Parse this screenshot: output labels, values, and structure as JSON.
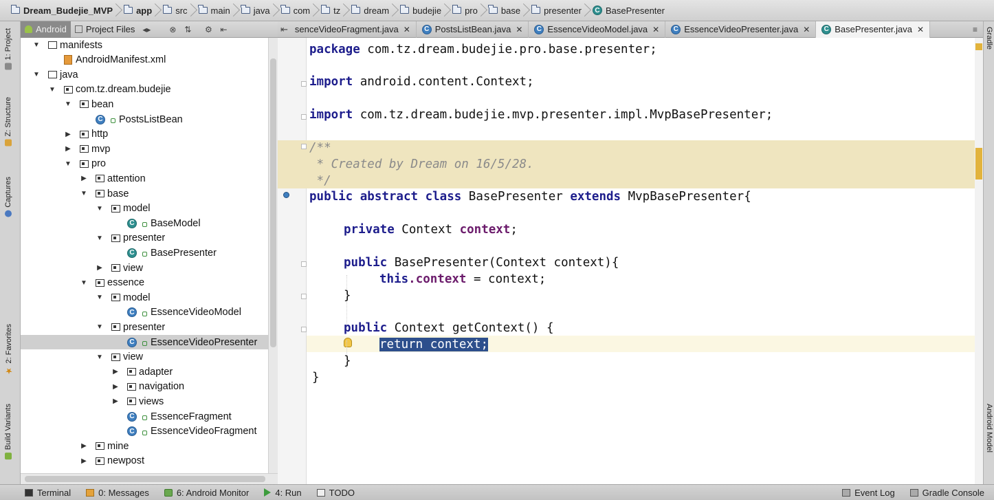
{
  "breadcrumbs": [
    {
      "label": "Dream_Budejie_MVP",
      "icon": "module-icon",
      "bold": true
    },
    {
      "label": "app",
      "icon": "folder-icon",
      "bold": true
    },
    {
      "label": "src",
      "icon": "folder-icon"
    },
    {
      "label": "main",
      "icon": "folder-icon"
    },
    {
      "label": "java",
      "icon": "folder-icon"
    },
    {
      "label": "com",
      "icon": "folder-icon"
    },
    {
      "label": "tz",
      "icon": "folder-icon"
    },
    {
      "label": "dream",
      "icon": "folder-icon"
    },
    {
      "label": "budejie",
      "icon": "folder-icon"
    },
    {
      "label": "pro",
      "icon": "folder-icon"
    },
    {
      "label": "base",
      "icon": "folder-icon"
    },
    {
      "label": "presenter",
      "icon": "folder-icon"
    },
    {
      "label": "BasePresenter",
      "icon": "class-icon"
    }
  ],
  "left_strip": {
    "project": "1: Project",
    "structure": "Z: Structure",
    "captures": "Captures",
    "favorites": "2: Favorites",
    "build_variants": "Build Variants"
  },
  "right_strip": {
    "gradle": "Gradle",
    "android_model": "Android Model"
  },
  "project_toolbar": {
    "android_tab": "Android",
    "project_files_tab": "Project Files"
  },
  "tree": [
    {
      "label": "manifests",
      "depth": 0,
      "arrow": "open",
      "icon": "dir"
    },
    {
      "label": "AndroidManifest.xml",
      "depth": 1,
      "arrow": "",
      "icon": "xml"
    },
    {
      "label": "java",
      "depth": 0,
      "arrow": "open",
      "icon": "dir"
    },
    {
      "label": "com.tz.dream.budejie",
      "depth": 1,
      "arrow": "open",
      "icon": "pkg"
    },
    {
      "label": "bean",
      "depth": 2,
      "arrow": "open",
      "icon": "pkg"
    },
    {
      "label": "PostsListBean",
      "depth": 3,
      "arrow": "",
      "icon": "class"
    },
    {
      "label": "http",
      "depth": 2,
      "arrow": "closed",
      "icon": "pkg"
    },
    {
      "label": "mvp",
      "depth": 2,
      "arrow": "closed",
      "icon": "pkg"
    },
    {
      "label": "pro",
      "depth": 2,
      "arrow": "open",
      "icon": "pkg"
    },
    {
      "label": "attention",
      "depth": 3,
      "arrow": "closed",
      "icon": "pkg"
    },
    {
      "label": "base",
      "depth": 3,
      "arrow": "open",
      "icon": "pkg"
    },
    {
      "label": "model",
      "depth": 4,
      "arrow": "open",
      "icon": "pkg"
    },
    {
      "label": "BaseModel",
      "depth": 5,
      "arrow": "",
      "icon": "class-teal"
    },
    {
      "label": "presenter",
      "depth": 4,
      "arrow": "open",
      "icon": "pkg"
    },
    {
      "label": "BasePresenter",
      "depth": 5,
      "arrow": "",
      "icon": "class-teal"
    },
    {
      "label": "view",
      "depth": 4,
      "arrow": "closed",
      "icon": "pkg"
    },
    {
      "label": "essence",
      "depth": 3,
      "arrow": "open",
      "icon": "pkg"
    },
    {
      "label": "model",
      "depth": 4,
      "arrow": "open",
      "icon": "pkg"
    },
    {
      "label": "EssenceVideoModel",
      "depth": 5,
      "arrow": "",
      "icon": "class"
    },
    {
      "label": "presenter",
      "depth": 4,
      "arrow": "open",
      "icon": "pkg"
    },
    {
      "label": "EssenceVideoPresenter",
      "depth": 5,
      "arrow": "",
      "icon": "class",
      "selected": true
    },
    {
      "label": "view",
      "depth": 4,
      "arrow": "open",
      "icon": "pkg"
    },
    {
      "label": "adapter",
      "depth": 5,
      "arrow": "closed",
      "icon": "pkg"
    },
    {
      "label": "navigation",
      "depth": 5,
      "arrow": "closed",
      "icon": "pkg"
    },
    {
      "label": "views",
      "depth": 5,
      "arrow": "closed",
      "icon": "pkg"
    },
    {
      "label": "EssenceFragment",
      "depth": 5,
      "arrow": "",
      "icon": "class"
    },
    {
      "label": "EssenceVideoFragment",
      "depth": 5,
      "arrow": "",
      "icon": "class"
    },
    {
      "label": "mine",
      "depth": 3,
      "arrow": "closed",
      "icon": "pkg"
    },
    {
      "label": "newpost",
      "depth": 3,
      "arrow": "closed",
      "icon": "pkg"
    }
  ],
  "editor_tabs": [
    {
      "label": "senceVideoFragment.java",
      "active": false
    },
    {
      "label": "PostsListBean.java",
      "active": false
    },
    {
      "label": "EssenceVideoModel.java",
      "active": false
    },
    {
      "label": "EssenceVideoPresenter.java",
      "active": false
    },
    {
      "label": "BasePresenter.java",
      "active": true
    }
  ],
  "code": {
    "package_kw": "package",
    "package_name": " com.tz.dream.budejie.pro.base.presenter;",
    "import_kw": "import",
    "import1": " android.content.Context;",
    "import2": " com.tz.dream.budejie.mvp.presenter.impl.MvpBasePresenter;",
    "doc1": "/**",
    "doc2": " * Created by Dream on 16/5/28.",
    "doc3": " */",
    "public_kw": "public",
    "abstract_kw": " abstract",
    "class_kw": " class",
    "class_name": " BasePresenter ",
    "extends_kw": "extends",
    "super_name": " MvpBasePresenter{",
    "private_kw": "private",
    "ctx_type": " Context ",
    "ctx_field": "context",
    "semicolon": ";",
    "ctor_sig": " BasePresenter(Context context){",
    "this_kw": "this",
    "this_field": ".context",
    "assign": " = context;",
    "close_brace": "}",
    "getter_sig": " Context getContext() {",
    "return_stmt": "return context;"
  },
  "bottom_bar": {
    "terminal": "Terminal",
    "messages": "0: Messages",
    "android_monitor": "6: Android Monitor",
    "run": "4: Run",
    "todo": "TODO",
    "event_log": "Event Log",
    "gradle_console": "Gradle Console"
  }
}
